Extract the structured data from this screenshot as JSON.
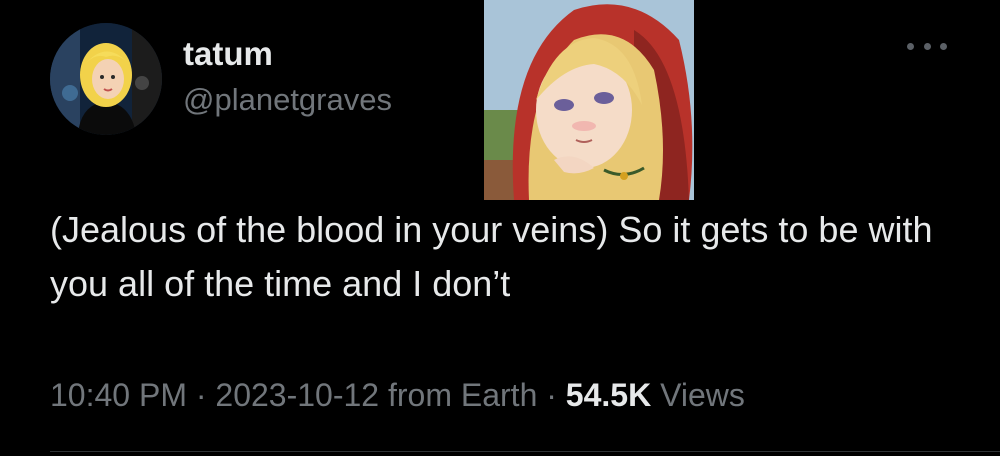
{
  "author": {
    "display_name": "tatum",
    "handle": "@planetgraves",
    "avatar_icon": "cartoon-blonde-woman-avatar"
  },
  "tweet": {
    "text": "(Jealous of the blood in your veins) So it gets to be with you all of the time and I don’t",
    "image_icon": "anime-blonde-character-red-hood"
  },
  "meta": {
    "time": "10:40 PM",
    "separator": "·",
    "date": "2023-10-12",
    "location": "from Earth",
    "views_count": "54.5K",
    "views_label": "Views"
  },
  "colors": {
    "background": "#000000",
    "text_primary": "#e7e9ea",
    "text_secondary": "#71767b",
    "divider": "#2f3336"
  }
}
